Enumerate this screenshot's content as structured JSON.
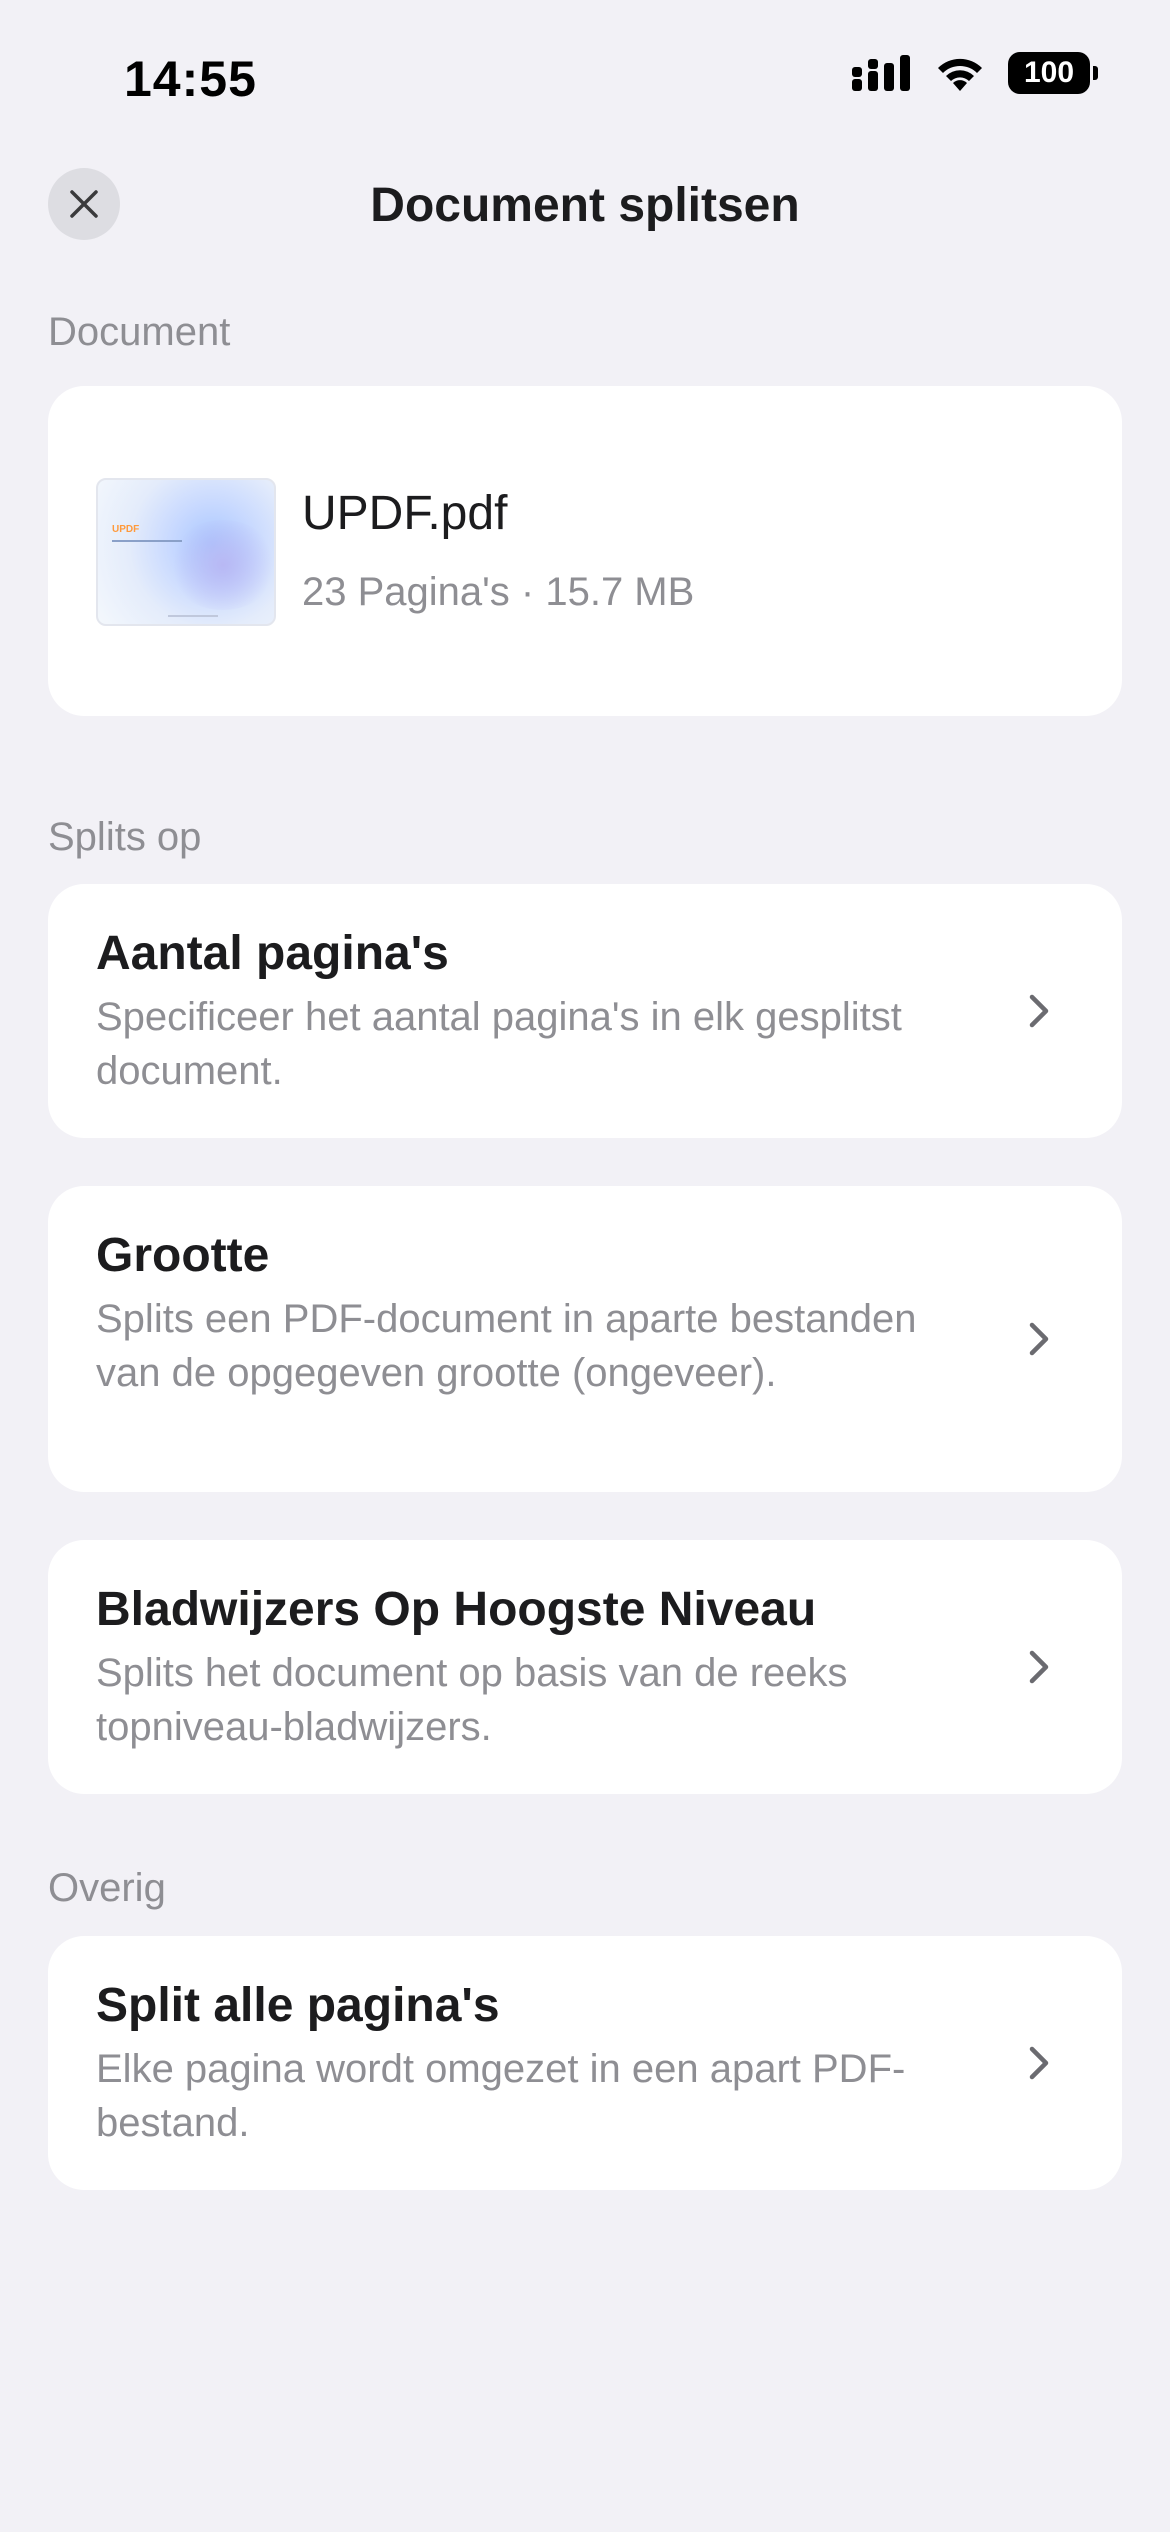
{
  "status_bar": {
    "time": "14:55",
    "battery": "100"
  },
  "header": {
    "title": "Document splitsen",
    "close_icon": "close-icon"
  },
  "document_section": {
    "label": "Document",
    "file": {
      "thumbnail_logo": "UPDF",
      "name": "UPDF.pdf",
      "meta": "23 Pagina's · 15.7 MB"
    }
  },
  "split_section": {
    "label": "Splits op",
    "options": [
      {
        "title": "Aantal pagina's",
        "description": "Specificeer het aantal pagina's in elk gesplitst document."
      },
      {
        "title": "Grootte",
        "description": "Splits een PDF-document in aparte bestanden van de opgegeven grootte (ongeveer)."
      },
      {
        "title": "Bladwijzers Op Hoogste Niveau",
        "description": "Splits het document op basis van de reeks topniveau-bladwijzers."
      }
    ]
  },
  "other_section": {
    "label": "Overig",
    "options": [
      {
        "title": "Split alle pagina's",
        "description": "Elke pagina wordt omgezet in een apart PDF-bestand."
      }
    ]
  },
  "colors": {
    "background": "#f2f1f6",
    "card": "#ffffff",
    "secondary_text": "#8e8e93",
    "primary_text": "#1c1c1e"
  }
}
